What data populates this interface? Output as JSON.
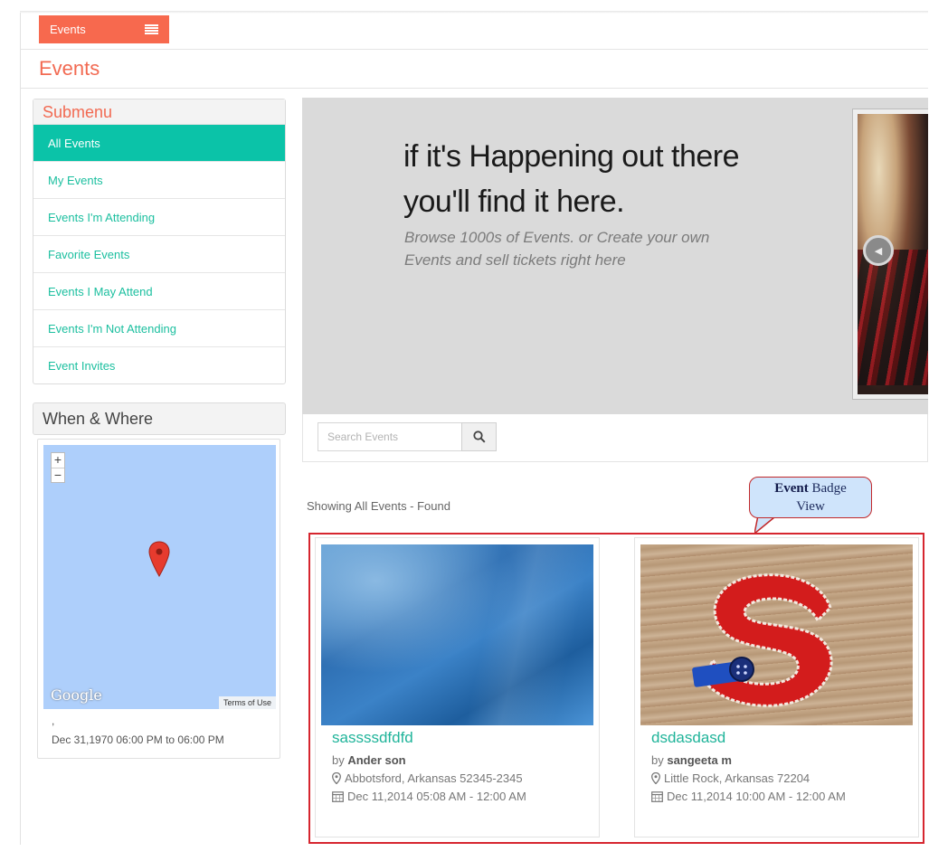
{
  "header": {
    "tab_label": "Events",
    "page_title": "Events"
  },
  "submenu": {
    "title": "Submenu",
    "items": [
      {
        "label": "All Events"
      },
      {
        "label": "My Events"
      },
      {
        "label": "Events I'm Attending"
      },
      {
        "label": "Favorite Events"
      },
      {
        "label": "Events I May Attend"
      },
      {
        "label": "Events I'm Not Attending"
      },
      {
        "label": "Event Invites"
      }
    ]
  },
  "when_where": {
    "title": "When & Where",
    "map": {
      "zoom_in": "+",
      "zoom_out": "−",
      "logo": "Google",
      "terms": "Terms of Use"
    },
    "address": ",",
    "date_range": "Dec 31,1970 06:00 PM to 06:00 PM"
  },
  "hero": {
    "headline_line1": "if it's Happening out there",
    "headline_line2": "you'll find it here.",
    "sub_line1": "Browse 1000s of Events. or Create your own",
    "sub_line2": "Events and sell tickets right here"
  },
  "search": {
    "placeholder": "Search Events"
  },
  "results": {
    "summary": "Showing All Events - Found"
  },
  "callout": {
    "bold": "Event",
    "rest": " Badge",
    "line2": "View"
  },
  "events": [
    {
      "title": "sassssdfdfd",
      "by_prefix": "by ",
      "author": "Ander son",
      "location": "Abbotsford, Arkansas 52345-2345",
      "date": "Dec 11,2014 05:08 AM - 12:00 AM"
    },
    {
      "title": "dsdasdasd",
      "by_prefix": "by ",
      "author": "sangeeta m",
      "location": "Little Rock, Arkansas 72204",
      "date": "Dec 11,2014 10:00 AM - 12:00 AM"
    }
  ],
  "colors": {
    "accent": "#f7694e",
    "teal": "#0bc3a8",
    "highlight": "#d6262f"
  }
}
